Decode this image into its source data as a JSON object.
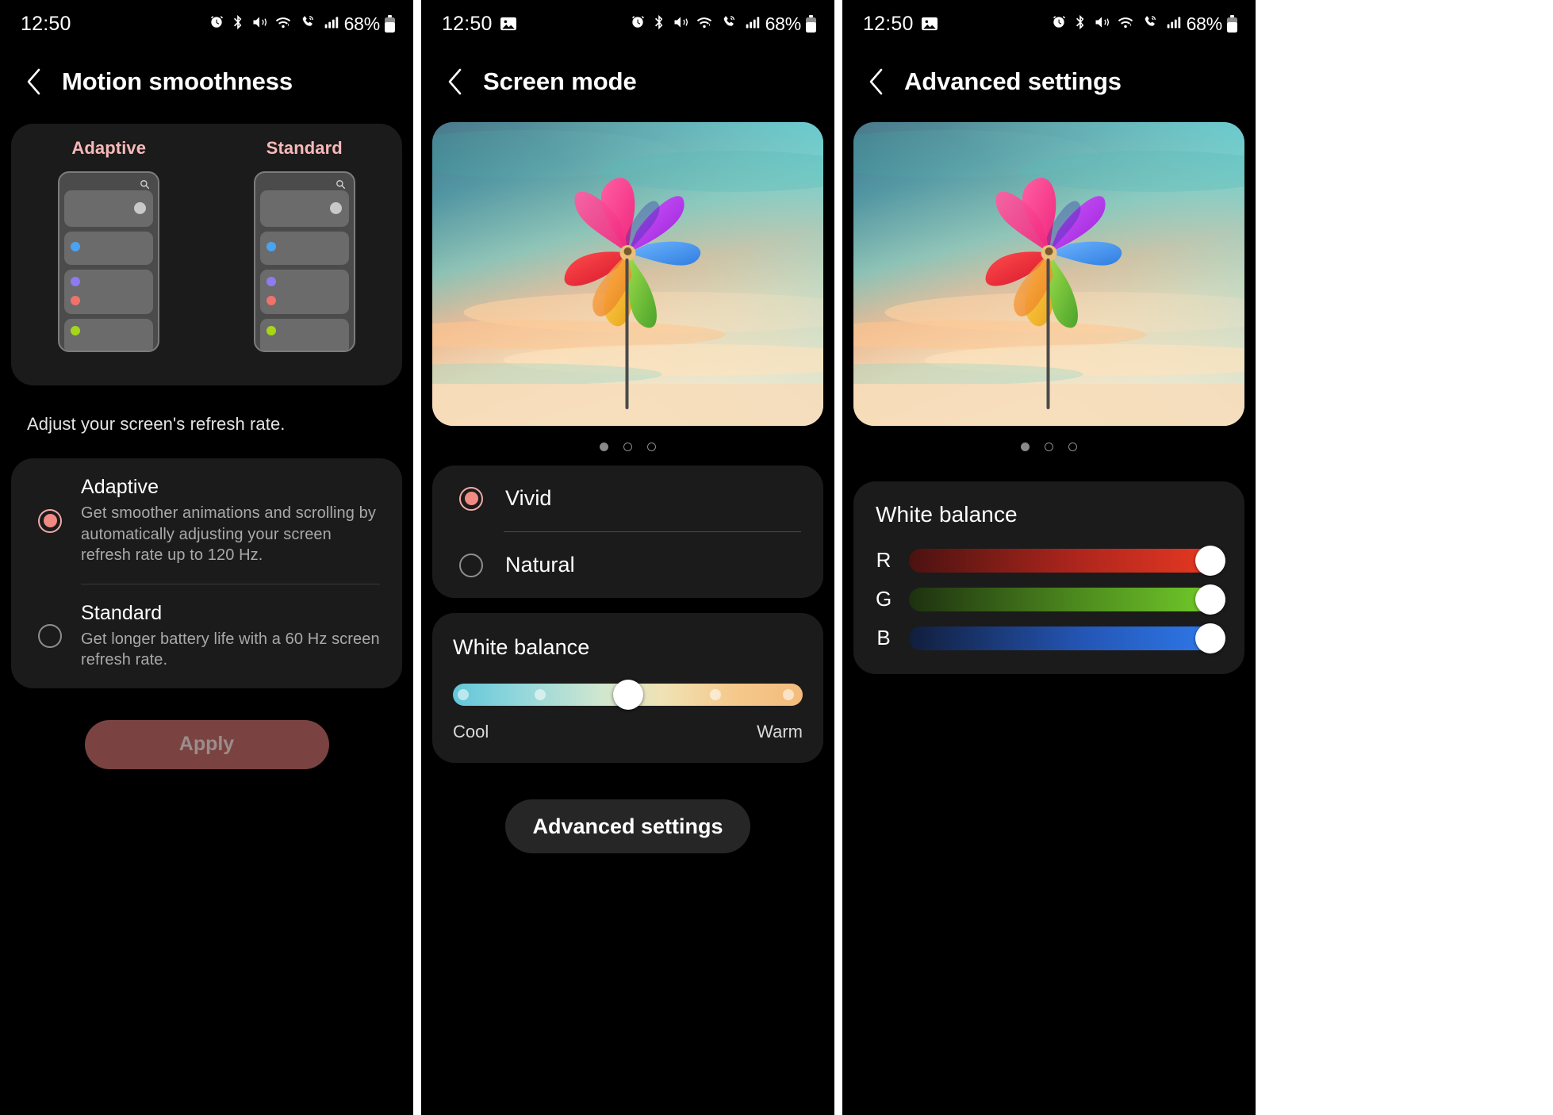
{
  "status_bar": {
    "time": "12:50",
    "battery_percent": "68%",
    "icons": [
      "alarm-icon",
      "bluetooth-icon",
      "mute-vibrate-icon",
      "wifi-icon",
      "wifi-calling-icon",
      "signal-bars-icon"
    ],
    "screenshot_icon": "image-icon",
    "battery_icon": "battery-icon"
  },
  "panel1": {
    "title": "Motion smoothness",
    "back_icon": "back-chevron-icon",
    "preview": {
      "left_label": "Adaptive",
      "right_label": "Standard",
      "label_color": "#f7b9b9",
      "search_icon": "search-icon"
    },
    "hint": "Adjust your screen's refresh rate.",
    "options": [
      {
        "title": "Adaptive",
        "desc": "Get smoother animations and scrolling by automatically adjusting your screen refresh rate up to 120 Hz.",
        "selected": true
      },
      {
        "title": "Standard",
        "desc": "Get longer battery life with a 60 Hz screen refresh rate.",
        "selected": false
      }
    ],
    "apply_label": "Apply",
    "apply_enabled": false,
    "accent_color": "#f08b84"
  },
  "panel2": {
    "title": "Screen mode",
    "back_icon": "back-chevron-icon",
    "hero_alt": "pinwheel-photo",
    "page_dots": {
      "count": 3,
      "active_index": 0
    },
    "modes": [
      {
        "label": "Vivid",
        "selected": true
      },
      {
        "label": "Natural",
        "selected": false
      }
    ],
    "white_balance": {
      "title": "White balance",
      "cool_label": "Cool",
      "warm_label": "Warm",
      "value_percent": 50,
      "tick_percents": [
        3,
        25,
        75,
        96
      ]
    },
    "advanced_label": "Advanced settings"
  },
  "panel3": {
    "title": "Advanced settings",
    "back_icon": "back-chevron-icon",
    "hero_alt": "pinwheel-photo",
    "page_dots": {
      "count": 3,
      "active_index": 0
    },
    "white_balance": {
      "title": "White balance",
      "channels": [
        {
          "letter": "R",
          "value_percent": 100,
          "color": "#ea3a22"
        },
        {
          "letter": "G",
          "value_percent": 100,
          "color": "#74cf2a"
        },
        {
          "letter": "B",
          "value_percent": 100,
          "color": "#2f7bee"
        }
      ]
    }
  }
}
